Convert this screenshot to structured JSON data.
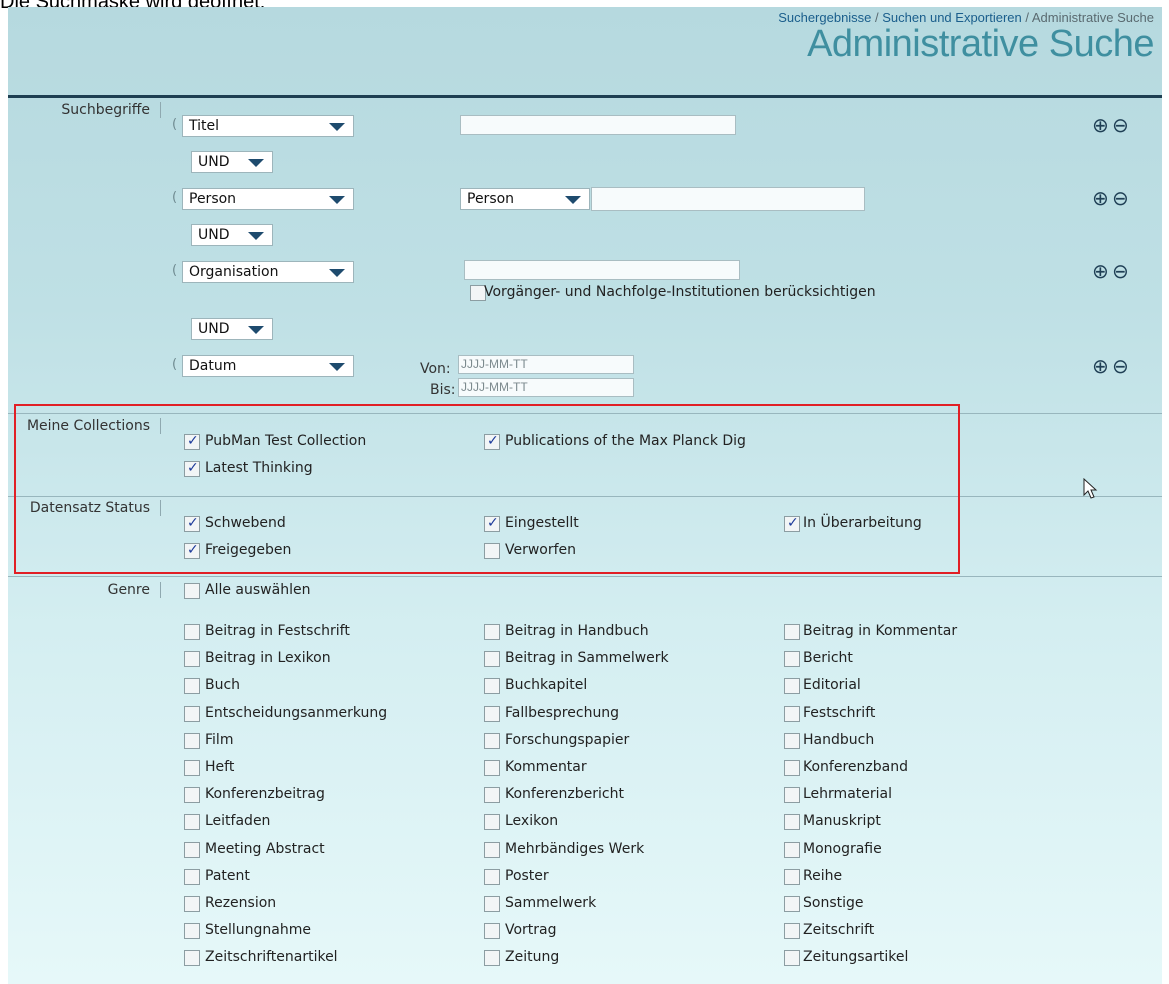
{
  "caption": "Die Suchmaske wird geöffnet:",
  "breadcrumb": {
    "item1": "Suchergebnisse",
    "sep1": " / ",
    "item2": "Suchen und Exportieren",
    "sep2": " / ",
    "current": "Administrative Suche"
  },
  "page_title": "Administrative Suche",
  "search_terms": {
    "label": "Suchbegriffe",
    "paren": "(",
    "row1": {
      "field": "Titel",
      "value": ""
    },
    "op1": "UND",
    "row2": {
      "field": "Person",
      "role": "Person",
      "value": ""
    },
    "op2": "UND",
    "row3": {
      "field": "Organisation",
      "value": "",
      "checkbox_label": "Vorgänger- und Nachfolge-Institutionen berücksichtigen",
      "checked": false
    },
    "op3": "UND",
    "row4": {
      "field": "Datum",
      "from_label": "Von:",
      "to_label": "Bis:",
      "from_placeholder": "JJJJ-MM-TT",
      "to_placeholder": "JJJJ-MM-TT"
    },
    "add_icon": "⊕",
    "remove_icon": "⊖"
  },
  "collections": {
    "label": "Meine Collections",
    "items": [
      {
        "label": "PubMan Test Collection",
        "checked": true
      },
      {
        "label": "Publications of the Max Planck Dig",
        "checked": true
      },
      {
        "label": "Latest Thinking",
        "checked": true
      }
    ]
  },
  "status": {
    "label": "Datensatz Status",
    "items": [
      {
        "label": "Schwebend",
        "checked": true
      },
      {
        "label": "Eingestellt",
        "checked": true
      },
      {
        "label": "In Überarbeitung",
        "checked": true
      },
      {
        "label": "Freigegeben",
        "checked": true
      },
      {
        "label": "Verworfen",
        "checked": false
      }
    ]
  },
  "genre": {
    "label": "Genre",
    "select_all": "Alle auswählen",
    "items": [
      "Beitrag in Festschrift",
      "Beitrag in Handbuch",
      "Beitrag in Kommentar",
      "Beitrag in Lexikon",
      "Beitrag in Sammelwerk",
      "Bericht",
      "Buch",
      "Buchkapitel",
      "Editorial",
      "Entscheidungsanmerkung",
      "Fallbesprechung",
      "Festschrift",
      "Film",
      "Forschungspapier",
      "Handbuch",
      "Heft",
      "Kommentar",
      "Konferenzband",
      "Konferenzbeitrag",
      "Konferenzbericht",
      "Lehrmaterial",
      "Leitfaden",
      "Lexikon",
      "Manuskript",
      "Meeting Abstract",
      "Mehrbändiges Werk",
      "Monografie",
      "Patent",
      "Poster",
      "Reihe",
      "Rezension",
      "Sammelwerk",
      "Sonstige",
      "Stellungnahme",
      "Vortrag",
      "Zeitschrift",
      "Zeitschriftenartikel",
      "Zeitung",
      "Zeitungsartikel"
    ]
  },
  "colors": {
    "accent_title": "#3f8fa0",
    "highlight_box": "#e11f25",
    "header_line": "#1e3f52"
  }
}
